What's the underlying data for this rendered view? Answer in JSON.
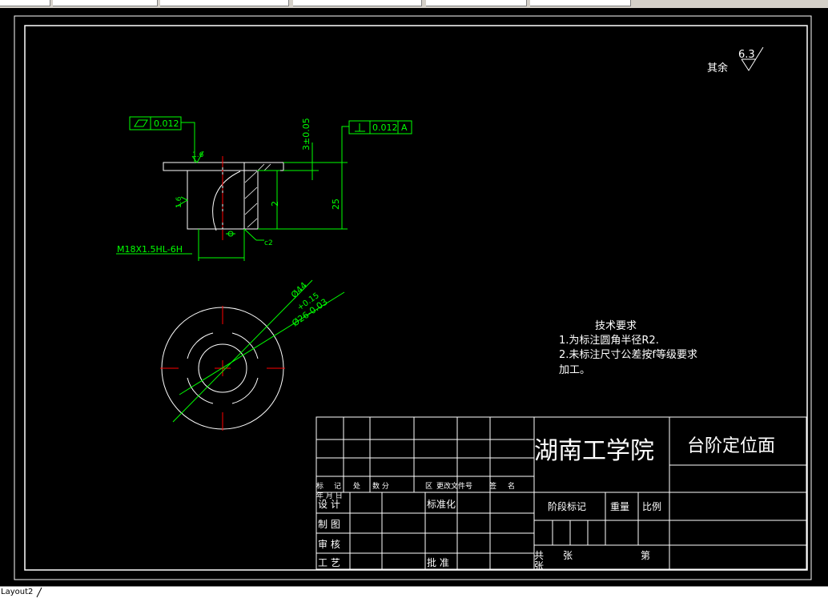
{
  "tab": {
    "label": "Layout2"
  },
  "roughness": {
    "prefix": "其余",
    "value": "6.3"
  },
  "tolerances": {
    "flatness": "0.012",
    "perpendicular": "0.012",
    "datum": "A",
    "thickness": "3±0.05",
    "height": "25",
    "inner_step": "2",
    "thread": "M18X1.5HL-6H",
    "chamfer": "c2",
    "finish_top": "1.6",
    "finish_side": "1.6",
    "outer_dia": "Ø44",
    "inner_tol": "+0.15",
    "inner_dia": "Ø26-0.03"
  },
  "notes": {
    "title": "技术要求",
    "line1": "1.为标注圆角半径R2.",
    "line2": "2.未标注尺寸公差按f等级要求",
    "line3": "加工。"
  },
  "title_block": {
    "school": "湖南工学院",
    "part_name": "台阶定位面",
    "stage_mark": "阶段标记",
    "weight": "重量",
    "scale": "比例",
    "total": "共",
    "sheets": "张",
    "sheet_no": "第",
    "sheets2": "张",
    "rev_headers": [
      "标",
      "记",
      "处",
      "数 分",
      "区",
      "更改文件号",
      "签",
      "名"
    ],
    "date_label": "年 月 日",
    "design": "设  计",
    "standard": "标准化",
    "draft": "制  图",
    "review": "审  核",
    "process": "工  艺",
    "approve": "批  准"
  }
}
